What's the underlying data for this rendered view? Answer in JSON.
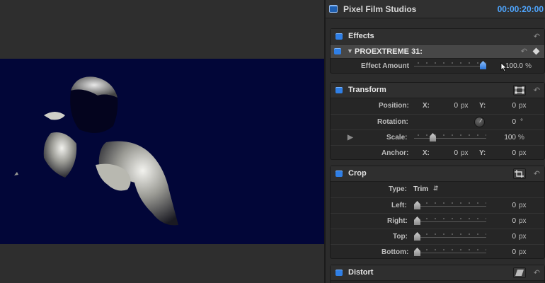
{
  "inspector": {
    "title": "Pixel Film Studios",
    "timecode": "00:00:20:00"
  },
  "effects": {
    "label": "Effects",
    "plugin": {
      "name": "PROEXTREME 31:",
      "amount_label": "Effect Amount",
      "amount_value": "100.0",
      "amount_unit": "%",
      "amount_fraction": 1.0
    }
  },
  "transform": {
    "label": "Transform",
    "position_label": "Position:",
    "position_x_label": "X:",
    "position_x": "0",
    "position_y_label": "Y:",
    "position_y": "0",
    "unit_px": "px",
    "rotation_label": "Rotation:",
    "rotation_value": "0",
    "rotation_unit": "°",
    "scale_label": "Scale:",
    "scale_value": "100",
    "scale_unit": "%",
    "anchor_label": "Anchor:",
    "anchor_x_label": "X:",
    "anchor_x": "0",
    "anchor_y_label": "Y:",
    "anchor_y": "0"
  },
  "crop": {
    "label": "Crop",
    "type_label": "Type:",
    "type_value": "Trim",
    "rows": [
      {
        "label": "Left:",
        "value": "0",
        "unit": "px"
      },
      {
        "label": "Right:",
        "value": "0",
        "unit": "px"
      },
      {
        "label": "Top:",
        "value": "0",
        "unit": "px"
      },
      {
        "label": "Bottom:",
        "value": "0",
        "unit": "px"
      }
    ]
  },
  "distort": {
    "label": "Distort"
  },
  "colors": {
    "accent": "#2f7fe6",
    "timecode": "#4fa6ff",
    "viewer_bg": "#020638"
  }
}
